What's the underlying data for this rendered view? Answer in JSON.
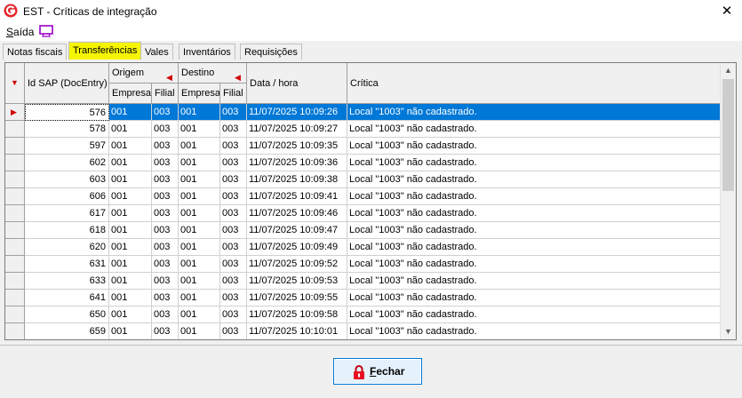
{
  "window": {
    "title": "EST - Críticas de integração",
    "close_glyph": "✕"
  },
  "menu": {
    "saida_first": "S",
    "saida_rest": "aída"
  },
  "tabs": [
    {
      "label": "Notas fiscais",
      "active": false
    },
    {
      "label": "Transferências",
      "active": true
    },
    {
      "label": "Vales",
      "active": false
    },
    {
      "label": "Inventários",
      "active": false
    },
    {
      "label": "Requisições",
      "active": false
    }
  ],
  "grid": {
    "headers": {
      "id": "Id SAP (DocEntry)",
      "origem": "Origem",
      "destino": "Destino",
      "empresa": "Empresa",
      "filial": "Filial",
      "data_hora": "Data / hora",
      "critica": "Crítica"
    },
    "rows": [
      {
        "id": "576",
        "oe": "001",
        "of": "003",
        "de": "001",
        "df": "003",
        "dt": "11/07/2025 10:09:26",
        "cr": "Local \"1003\" não cadastrado."
      },
      {
        "id": "578",
        "oe": "001",
        "of": "003",
        "de": "001",
        "df": "003",
        "dt": "11/07/2025 10:09:27",
        "cr": "Local \"1003\" não cadastrado."
      },
      {
        "id": "597",
        "oe": "001",
        "of": "003",
        "de": "001",
        "df": "003",
        "dt": "11/07/2025 10:09:35",
        "cr": "Local \"1003\" não cadastrado."
      },
      {
        "id": "602",
        "oe": "001",
        "of": "003",
        "de": "001",
        "df": "003",
        "dt": "11/07/2025 10:09:36",
        "cr": "Local \"1003\" não cadastrado."
      },
      {
        "id": "603",
        "oe": "001",
        "of": "003",
        "de": "001",
        "df": "003",
        "dt": "11/07/2025 10:09:38",
        "cr": "Local \"1003\" não cadastrado."
      },
      {
        "id": "606",
        "oe": "001",
        "of": "003",
        "de": "001",
        "df": "003",
        "dt": "11/07/2025 10:09:41",
        "cr": "Local \"1003\" não cadastrado."
      },
      {
        "id": "617",
        "oe": "001",
        "of": "003",
        "de": "001",
        "df": "003",
        "dt": "11/07/2025 10:09:46",
        "cr": "Local \"1003\" não cadastrado."
      },
      {
        "id": "618",
        "oe": "001",
        "of": "003",
        "de": "001",
        "df": "003",
        "dt": "11/07/2025 10:09:47",
        "cr": "Local \"1003\" não cadastrado."
      },
      {
        "id": "620",
        "oe": "001",
        "of": "003",
        "de": "001",
        "df": "003",
        "dt": "11/07/2025 10:09:49",
        "cr": "Local \"1003\" não cadastrado."
      },
      {
        "id": "631",
        "oe": "001",
        "of": "003",
        "de": "001",
        "df": "003",
        "dt": "11/07/2025 10:09:52",
        "cr": "Local \"1003\" não cadastrado."
      },
      {
        "id": "633",
        "oe": "001",
        "of": "003",
        "de": "001",
        "df": "003",
        "dt": "11/07/2025 10:09:53",
        "cr": "Local \"1003\" não cadastrado."
      },
      {
        "id": "641",
        "oe": "001",
        "of": "003",
        "de": "001",
        "df": "003",
        "dt": "11/07/2025 10:09:55",
        "cr": "Local \"1003\" não cadastrado."
      },
      {
        "id": "650",
        "oe": "001",
        "of": "003",
        "de": "001",
        "df": "003",
        "dt": "11/07/2025 10:09:58",
        "cr": "Local \"1003\" não cadastrado."
      },
      {
        "id": "659",
        "oe": "001",
        "of": "003",
        "de": "001",
        "df": "003",
        "dt": "11/07/2025 10:10:01",
        "cr": "Local \"1003\" não cadastrado."
      }
    ],
    "selected_row": 0
  },
  "footer": {
    "close_first": "F",
    "close_rest": "echar"
  },
  "colors": {
    "selection": "#0078d7",
    "active_tab": "#f5f500",
    "sort_arrow": "#d00000",
    "lock": "#e81123"
  }
}
